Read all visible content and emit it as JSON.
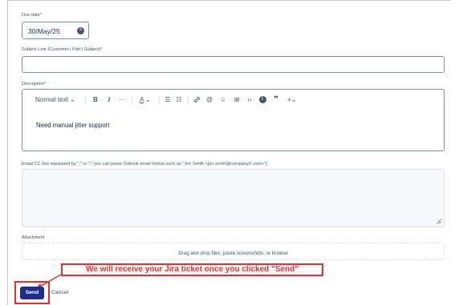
{
  "due_date": {
    "label": "Due date",
    "required_mark": "*",
    "value": "30/May/25",
    "clear_icon": "×"
  },
  "subject": {
    "label": "Subject Line (Customer | Part | Subject)",
    "required_mark": "*",
    "value": ""
  },
  "description": {
    "label": "Description",
    "required_mark": "*",
    "toolbar": {
      "text_style": "Normal text",
      "text_style_chevron": "⌄",
      "bold": "B",
      "italic": "I",
      "more": "···",
      "text_color": "A",
      "text_color_chevron": "⌄",
      "bullet_list": "☰",
      "numbered_list": "☷",
      "link": "🔗",
      "mention": "@",
      "emoji": "☺",
      "table": "⊞",
      "code": "‹›",
      "info": "ℹ",
      "quote": "❞",
      "insert": "+",
      "insert_chevron": "⌄"
    },
    "body": "Need manual jitter support"
  },
  "email_cc": {
    "label": "Email CC (list separated by \",\" or \";\" you can paste Outlook email format such as \"Jon Smith <jon.smith@companyX.com>\")",
    "value": ""
  },
  "attachment": {
    "label": "Attachment",
    "dropzone_text": "Drag and drop files, paste screenshots, or browse"
  },
  "callout_text": "We will receive your Jira ticket once you clicked \"Send\"",
  "actions": {
    "send_label": "Send",
    "cancel_label": "Cancel"
  },
  "colors": {
    "accent": "#1d2e8f",
    "annotation": "#e03131",
    "required": "#c9372c"
  }
}
